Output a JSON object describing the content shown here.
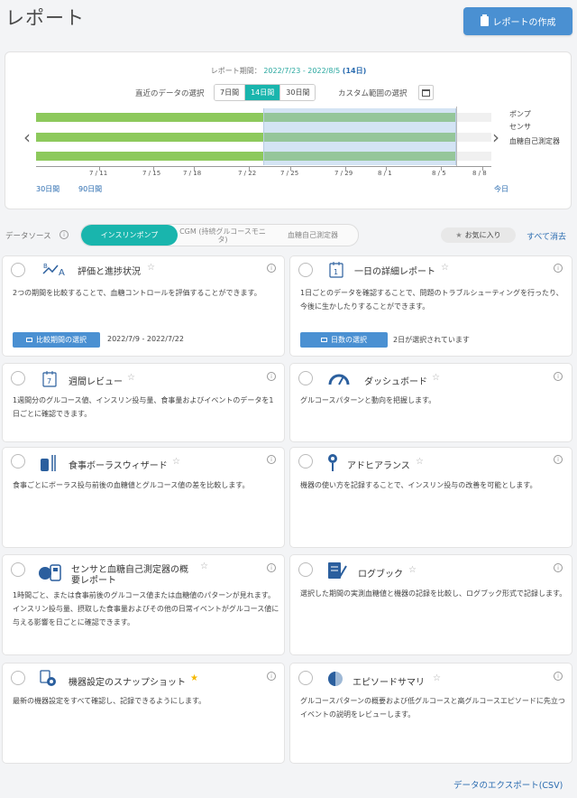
{
  "page": {
    "title": "レポート",
    "create_label": "レポートの作成"
  },
  "period": {
    "label": "レポート期間：",
    "dates": "2022/7/23 - 2022/8/5",
    "days": "(14日)",
    "recent_label": "直近のデータの選択",
    "options": [
      "7日間",
      "14日間",
      "30日間"
    ],
    "selected": "14日間",
    "custom_label": "カスタム範囲の選択"
  },
  "timeline": {
    "series": [
      "ポンプ",
      "センサ",
      "血糖自己測定器"
    ],
    "tick_labels": [
      "7 / 11",
      "7 / 15",
      "7 / 18",
      "7 / 22",
      "7 / 25",
      "7 / 29",
      "8 / 1",
      "8 / 5",
      "8 / 8"
    ],
    "link_30": "30日間",
    "link_90": "90日間",
    "today": "今日"
  },
  "datasource": {
    "label": "データソース",
    "tabs": [
      "インスリンポンプ",
      "CGM (持続グルコースモニタ)",
      "血糖自己測定器"
    ],
    "active": "インスリンポンプ",
    "favorites": "お気に入り",
    "clear_all": "すべて消去"
  },
  "cards": [
    {
      "title": "評価と進捗状況",
      "star": "☆",
      "desc": "2つの期間を比較することで、血糖コントロールを評価することができます。",
      "button": "比較期間の選択",
      "sub": "2022/7/9 - 2022/7/22"
    },
    {
      "title": "一日の詳細レポート",
      "star": "☆",
      "desc": "1日ごとのデータを確認することで、問題のトラブルシューティングを行ったり、今後に生かしたりすることができます。",
      "button": "日数の選択",
      "sub": "2日が選択されています"
    },
    {
      "title": "週間レビュー",
      "star": "☆",
      "desc": "1週間分のグルコース値、インスリン投与量、食事量およびイベントのデータを1日ごとに確認できます。"
    },
    {
      "title": "ダッシュボード",
      "star": "☆",
      "desc": "グルコースパターンと動向を把握します。"
    },
    {
      "title": "食事ボーラスウィザード",
      "star": "☆",
      "desc": "食事ごとにボーラス投与前後の血糖値とグルコース値の差を比較します。"
    },
    {
      "title": "アドヒアランス",
      "star": "☆",
      "desc": "機器の使い方を記録することで、インスリン投与の改善を可能とします。"
    },
    {
      "title1": "センサと血糖自己測定器の概",
      "title2": "要レポート",
      "star": "☆",
      "desc": "1時間ごと、または食事前後のグルコース値または血糖値のパターンが見れます。インスリン投与量、摂取した食事量およびその他の日常イベントがグルコース値に与える影響を日ごとに確認できます。"
    },
    {
      "title": "ログブック",
      "star": "☆",
      "desc": "選択した期間の実測血糖値と機器の記録を比較し、ログブック形式で記録します。"
    },
    {
      "title": "機器設定のスナップショット",
      "star": "★",
      "desc": "最新の機器設定をすべて確認し、記録できるようにします。"
    },
    {
      "title": "エピソードサマリ",
      "star": "☆",
      "desc": "グルコースパターンの概要および低グルコースと高グルコースエピソードに先立つイベントの説明をレビューします。"
    }
  ],
  "export_label": "データのエクスポート(CSV)",
  "colors": {
    "accent": "#19b5ad",
    "primary": "#4a90d2",
    "bar": "#8dc95c",
    "link": "#2b6cb0"
  }
}
